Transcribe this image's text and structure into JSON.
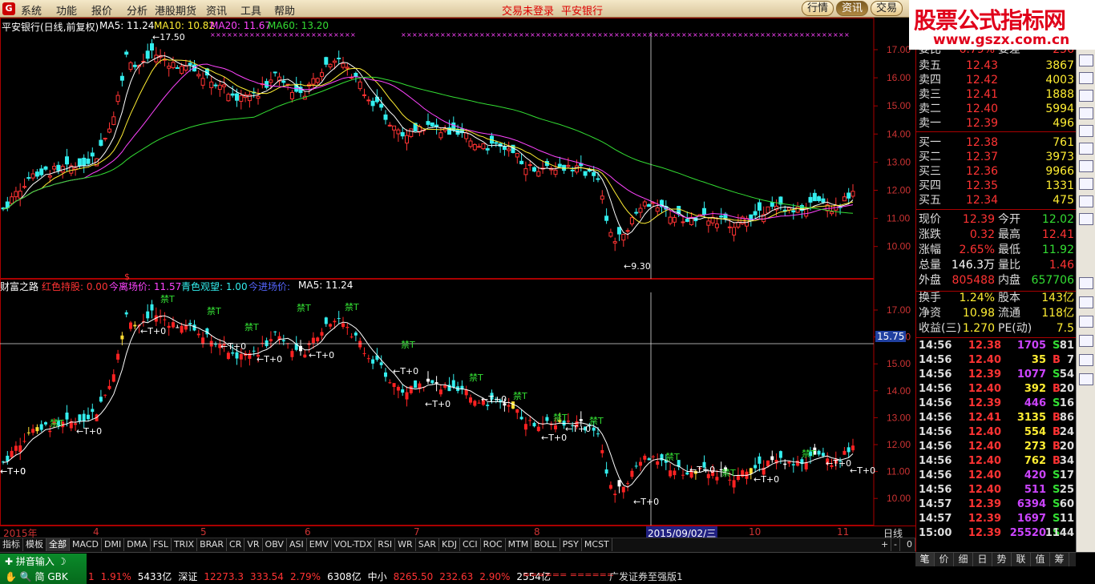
{
  "menubar": {
    "logo": "G",
    "items": [
      "系统",
      "功能",
      "报价",
      "分析",
      "港股期货",
      "资讯",
      "工具",
      "帮助"
    ],
    "center": [
      "交易未登录",
      "平安银行"
    ],
    "right_buttons": [
      {
        "label": "行情",
        "active": false
      },
      {
        "label": "资讯",
        "active": true
      },
      {
        "label": "交易",
        "active": false
      }
    ]
  },
  "watermark": {
    "line1": "股票公式指标网",
    "line2": "www.gszx.com.cn"
  },
  "main_chart": {
    "title": "平安银行(日线,前复权)",
    "ma_labels": [
      {
        "text": "MA5: 11.24",
        "color": "#ffffff"
      },
      {
        "text": "MA10: 10.82",
        "color": "#ffee33"
      },
      {
        "text": "MA20: 11.67",
        "color": "#ff44ff"
      },
      {
        "text": "MA60: 13.20",
        "color": "#33dd33"
      }
    ],
    "high_label": "17.50",
    "low_label": "9.30",
    "y_ticks": [
      "17.00",
      "16.00",
      "15.00",
      "14.00",
      "13.00",
      "12.00",
      "11.00",
      "10.00"
    ]
  },
  "sub_chart": {
    "title": "财富之路",
    "labels": [
      {
        "text": "红色持股: 0.00",
        "color": "#ff3333"
      },
      {
        "text": "今离场价: 11.57",
        "color": "#ff44ff"
      },
      {
        "text": "青色观望: 1.00",
        "color": "#33eeee"
      },
      {
        "text": "今进场价: ",
        "color": "#5566ff"
      },
      {
        "text": "MA5: 11.24",
        "color": "#ffffff"
      }
    ],
    "cursor_price": "15.75",
    "y_ticks": [
      "17.00",
      "16.00",
      "15.00",
      "14.00",
      "13.00",
      "12.00",
      "11.00",
      "10.00"
    ],
    "annotations": {
      "ban": "禁T",
      "t0": "←T+0"
    }
  },
  "xaxis": {
    "ticks": [
      {
        "label": "2015年"
      },
      {
        "label": "4"
      },
      {
        "label": "5"
      },
      {
        "label": "6"
      },
      {
        "label": "7"
      },
      {
        "label": "8"
      },
      {
        "label": "10"
      },
      {
        "label": "11"
      }
    ],
    "cursor_date": "2015/09/02/三",
    "period": "日线"
  },
  "indicator_tabs": [
    "指标",
    "模板",
    "全部",
    "MACD",
    "DMI",
    "DMA",
    "FSL",
    "TRIX",
    "BRAR",
    "CR",
    "VR",
    "OBV",
    "ASI",
    "EMV",
    "VOL-TDX",
    "RSI",
    "WR",
    "SAR",
    "KDJ",
    "CCI",
    "ROC",
    "MTM",
    "BOLL",
    "PSY",
    "MCST"
  ],
  "indicator_tabs_selected": "全部",
  "indicator_controls": [
    "+",
    "-",
    "0"
  ],
  "quote": {
    "header_partial": {
      "k": "委比",
      "v": "6.79%",
      "k2": "委差",
      "v2": "256"
    },
    "asks": [
      {
        "label": "卖五",
        "price": "12.43",
        "vol": "3867"
      },
      {
        "label": "卖四",
        "price": "12.42",
        "vol": "4003"
      },
      {
        "label": "卖三",
        "price": "12.41",
        "vol": "1888"
      },
      {
        "label": "卖二",
        "price": "12.40",
        "vol": "5994"
      },
      {
        "label": "卖一",
        "price": "12.39",
        "vol": "496"
      }
    ],
    "bids": [
      {
        "label": "买一",
        "price": "12.38",
        "vol": "761"
      },
      {
        "label": "买二",
        "price": "12.37",
        "vol": "3973"
      },
      {
        "label": "买三",
        "price": "12.36",
        "vol": "9966"
      },
      {
        "label": "买四",
        "price": "12.35",
        "vol": "1331"
      },
      {
        "label": "买五",
        "price": "12.34",
        "vol": "475"
      }
    ],
    "stats": [
      {
        "k": "现价",
        "v": "12.39",
        "c1": "red",
        "k2": "今开",
        "v2": "12.02",
        "c2": "grn"
      },
      {
        "k": "涨跌",
        "v": "0.32",
        "c1": "red",
        "k2": "最高",
        "v2": "12.41",
        "c2": "red"
      },
      {
        "k": "涨幅",
        "v": "2.65%",
        "c1": "red",
        "k2": "最低",
        "v2": "11.92",
        "c2": "grn"
      },
      {
        "k": "总量",
        "v": "146.3万",
        "c1": "wht",
        "k2": "量比",
        "v2": "1.46",
        "c2": "red"
      },
      {
        "k": "外盘",
        "v": "805488",
        "c1": "red",
        "k2": "内盘",
        "v2": "657706",
        "c2": "grn"
      }
    ],
    "fundamentals": [
      {
        "k": "换手",
        "v": "1.24%",
        "k2": "股本",
        "v2": "143亿"
      },
      {
        "k": "净资",
        "v": "10.98",
        "k2": "流通",
        "v2": "118亿"
      },
      {
        "k": "收益(三)",
        "v": "1.270",
        "k2": "PE(动)",
        "v2": "7.5"
      }
    ],
    "ticks": [
      {
        "t": "14:56",
        "p": "12.38",
        "q": "1705",
        "s": "S",
        "n": "81"
      },
      {
        "t": "14:56",
        "p": "12.40",
        "q": "35",
        "s": "B",
        "n": "7"
      },
      {
        "t": "14:56",
        "p": "12.39",
        "q": "1077",
        "s": "S",
        "n": "54"
      },
      {
        "t": "14:56",
        "p": "12.40",
        "q": "392",
        "s": "B",
        "n": "20"
      },
      {
        "t": "14:56",
        "p": "12.39",
        "q": "446",
        "s": "S",
        "n": "16"
      },
      {
        "t": "14:56",
        "p": "12.41",
        "q": "3135",
        "s": "B",
        "n": "86"
      },
      {
        "t": "14:56",
        "p": "12.40",
        "q": "554",
        "s": "B",
        "n": "24"
      },
      {
        "t": "14:56",
        "p": "12.40",
        "q": "273",
        "s": "B",
        "n": "20"
      },
      {
        "t": "14:56",
        "p": "12.40",
        "q": "762",
        "s": "B",
        "n": "34"
      },
      {
        "t": "14:56",
        "p": "12.40",
        "q": "420",
        "s": "S",
        "n": "17"
      },
      {
        "t": "14:56",
        "p": "12.40",
        "q": "511",
        "s": "S",
        "n": "25"
      },
      {
        "t": "14:57",
        "p": "12.39",
        "q": "6394",
        "s": "S",
        "n": "60"
      },
      {
        "t": "14:57",
        "p": "12.39",
        "q": "1697",
        "s": "S",
        "n": "11"
      },
      {
        "t": "15:00",
        "p": "12.39",
        "q": "25520",
        "s": "S",
        "n": "1144"
      }
    ]
  },
  "right_tabs": [
    "笔",
    "价",
    "细",
    "日",
    "势",
    "联",
    "值",
    "筹"
  ],
  "right_tabs_selected": "笔",
  "ime": {
    "label": "拼音输入",
    "mode": "简 GBK"
  },
  "ticker": [
    {
      "text": "1",
      "color": "#ff3333"
    },
    {
      "text": "1.91%",
      "color": "#ff3333"
    },
    {
      "text": "5433亿",
      "color": "#ffffff"
    },
    {
      "text": "深证",
      "color": "#ffffff"
    },
    {
      "text": "12273.3",
      "color": "#ff3333"
    },
    {
      "text": "333.54",
      "color": "#ff3333"
    },
    {
      "text": "2.79%",
      "color": "#ff3333"
    },
    {
      "text": "6308亿",
      "color": "#ffffff"
    },
    {
      "text": "中小",
      "color": "#ffffff"
    },
    {
      "text": "8265.50",
      "color": "#ff3333"
    },
    {
      "text": "232.63",
      "color": "#ff3333"
    },
    {
      "text": "2.90%",
      "color": "#ff3333"
    },
    {
      "text": "2554亿",
      "color": "#ffffff"
    }
  ],
  "broker": "广发证券至强版1"
}
